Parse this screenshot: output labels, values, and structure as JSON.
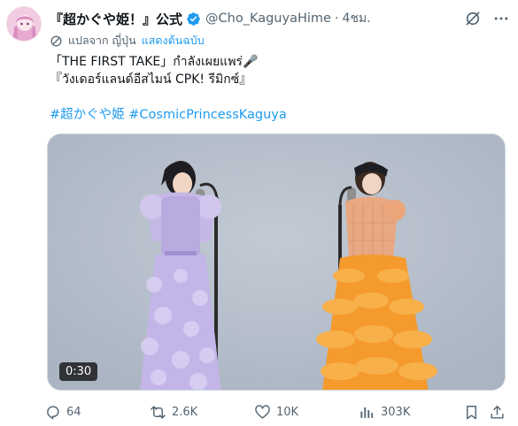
{
  "author": {
    "display_name": "『超かぐや姫！』公式",
    "handle": "@Cho_KaguyaHime",
    "separator": "·",
    "time": "4ชม."
  },
  "translation": {
    "label": "แปลจาก ญี่ปุ่น",
    "show_original": "แสดงต้นฉบับ"
  },
  "body": {
    "line1": "「THE FIRST TAKE」กำลังเผยแพร่🎤",
    "line2": "『วังเดอร์แลนด์อีสไมน์ CPK! รีมิกซ์』"
  },
  "hashtags": [
    "#超かぐや姫",
    "#CosmicPrincessKaguya"
  ],
  "media": {
    "duration": "0:30"
  },
  "actions": {
    "replies": "64",
    "reposts": "2.6K",
    "likes": "10K",
    "views": "303K"
  },
  "icons": {
    "verified": "verified-badge-icon",
    "grok": "grok-icon",
    "more": "more-icon",
    "translate": "translate-icon",
    "reply": "reply-icon",
    "repost": "repost-icon",
    "like": "like-icon",
    "views": "views-icon",
    "bookmark": "bookmark-icon",
    "share": "share-icon"
  },
  "colors": {
    "accent": "#1d9bf0",
    "secondary_text": "#536471",
    "primary_text": "#0f1419"
  }
}
